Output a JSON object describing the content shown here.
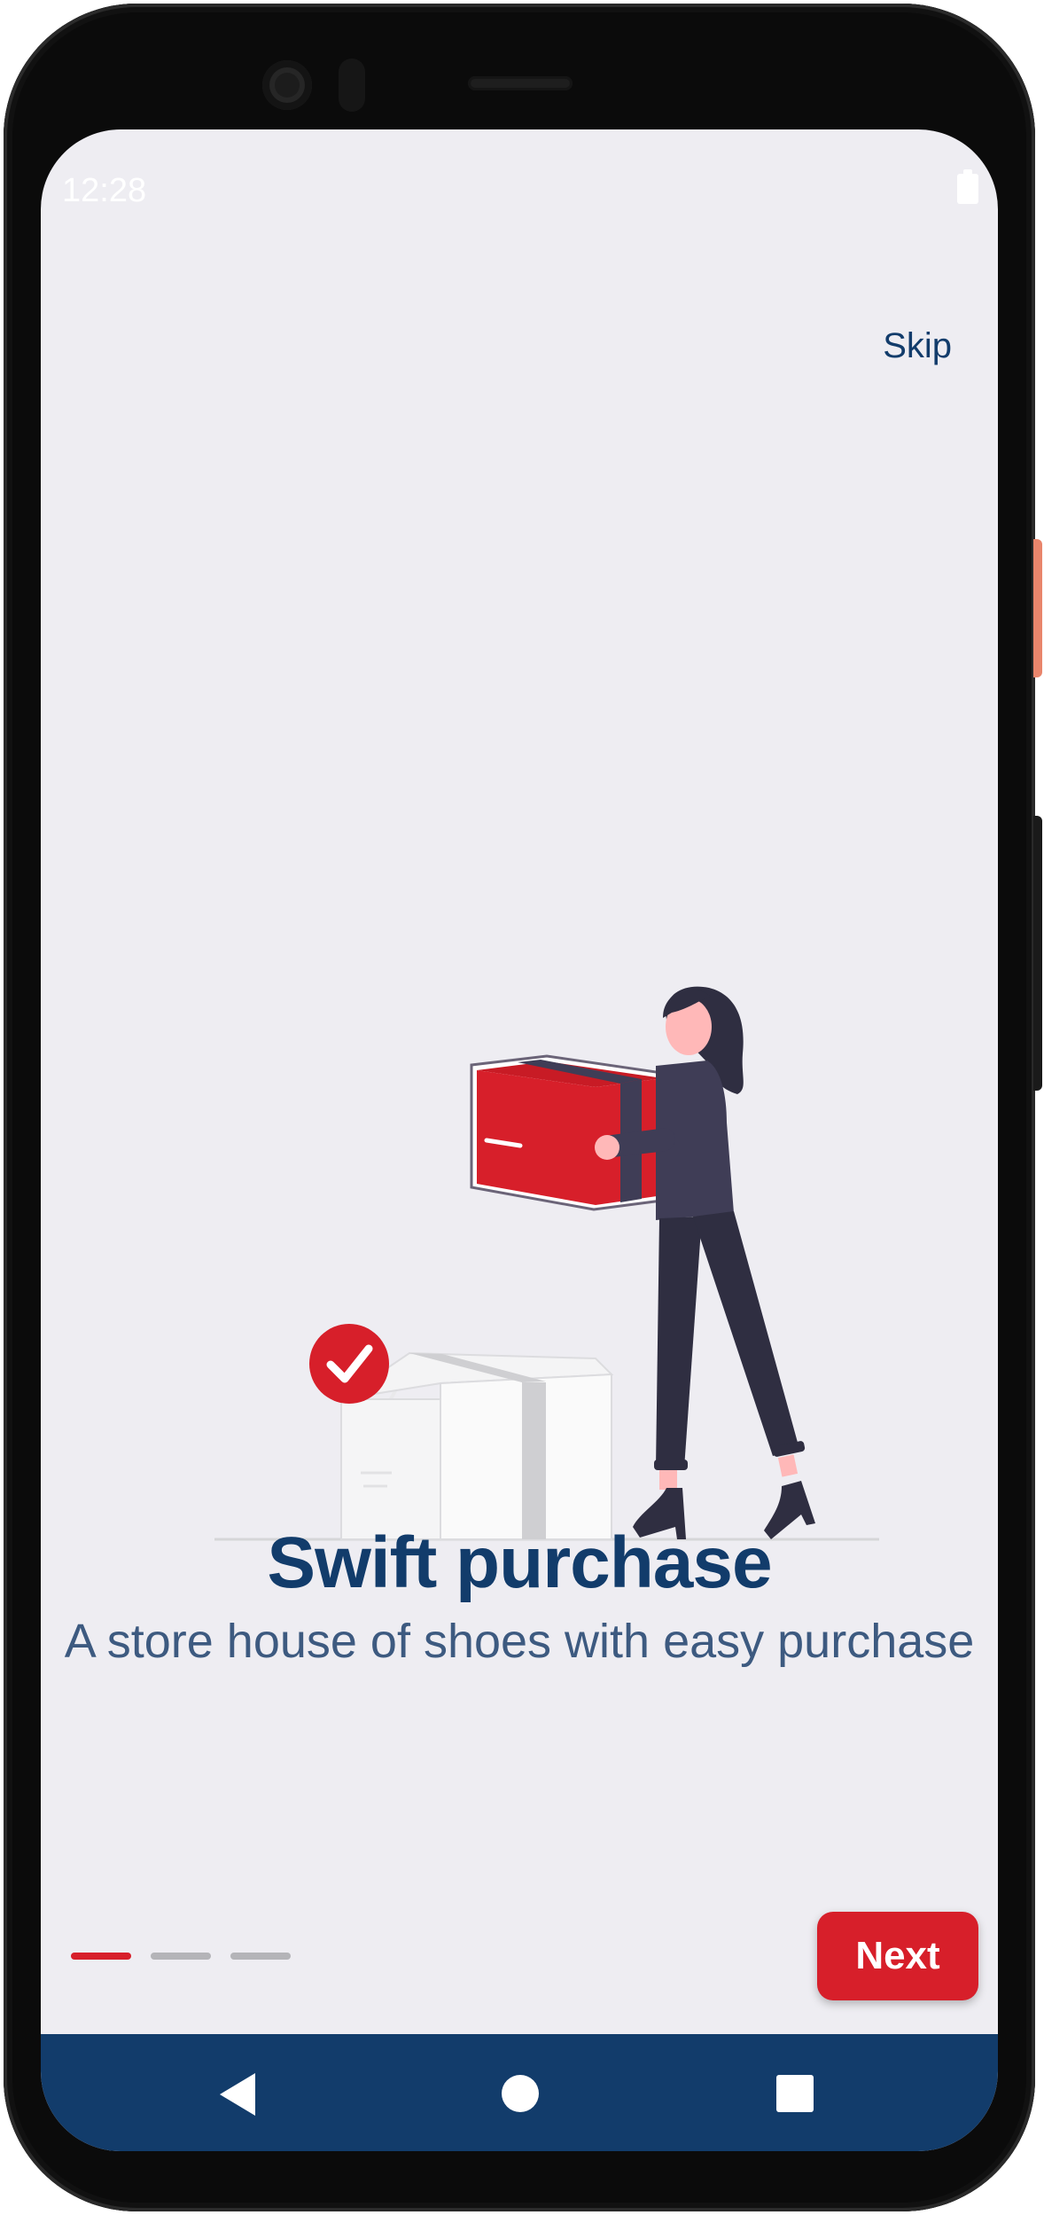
{
  "status_bar": {
    "time": "12:28",
    "battery_icon": "battery-full-icon"
  },
  "onboarding": {
    "skip_label": "Skip",
    "title": "Swift purchase",
    "subtitle": "A store house of shoes with easy purchase",
    "page_count": 3,
    "active_page": 1,
    "next_label": "Next",
    "illustration": "woman-carrying-box-illustration"
  },
  "nav_bar": {
    "back_icon": "back-triangle-icon",
    "home_icon": "home-circle-icon",
    "recents_icon": "recents-square-icon"
  },
  "colors": {
    "brand_navy": "#123c6b",
    "accent_red": "#d71f2a",
    "screen_bg": "#eeedf2",
    "indicator_inactive": "#b4b4b8"
  }
}
